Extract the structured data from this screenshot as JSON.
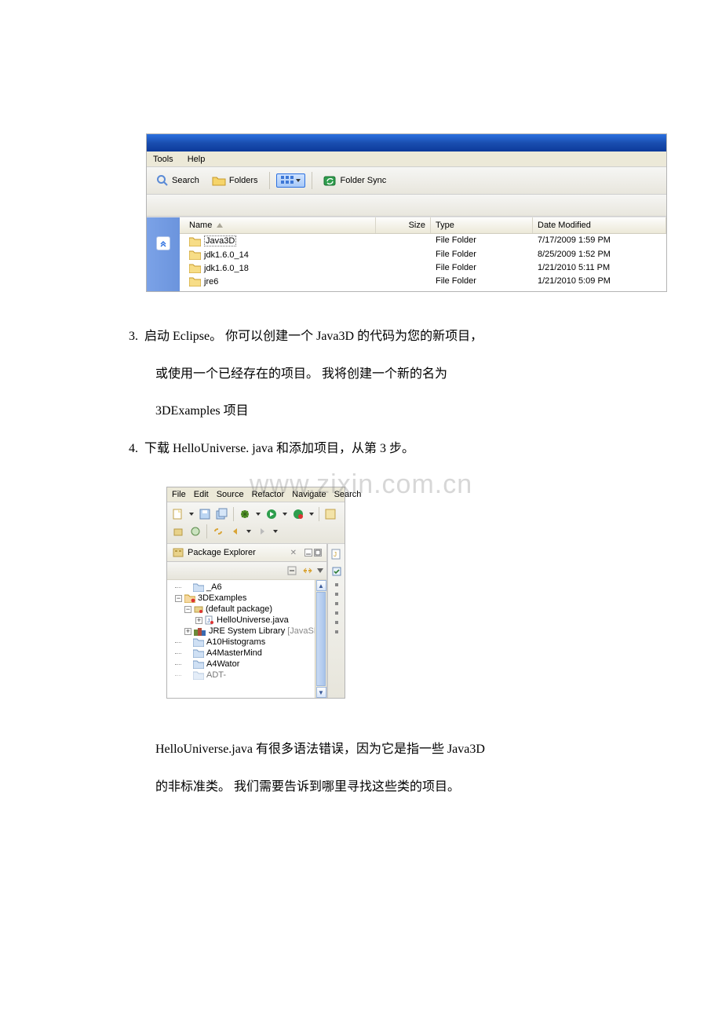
{
  "explorer": {
    "menus": {
      "tools": "Tools",
      "help": "Help"
    },
    "toolbar": {
      "search": "Search",
      "folders": "Folders",
      "folder_sync": "Folder Sync"
    },
    "columns": {
      "name": "Name",
      "size": "Size",
      "type": "Type",
      "date": "Date Modified"
    },
    "rows": [
      {
        "name": "Java3D",
        "type": "File Folder",
        "date": "7/17/2009 1:59 PM",
        "selected": true
      },
      {
        "name": "jdk1.6.0_14",
        "type": "File Folder",
        "date": "8/25/2009 1:52 PM",
        "selected": false
      },
      {
        "name": "jdk1.6.0_18",
        "type": "File Folder",
        "date": "1/21/2010 5:11 PM",
        "selected": false
      },
      {
        "name": "jre6",
        "type": "File Folder",
        "date": "1/21/2010 5:09 PM",
        "selected": false
      }
    ]
  },
  "doc": {
    "p3a": "启动 Eclipse。   你可以创建一个 Java3D 的代码为您的新项目，",
    "p3b": "或使用一个已经存在的项目。   我将创建一个新的名为",
    "p3c": "3DExamples 项目",
    "p4": "下载 HelloUniverse. java 和添加项目，从第 3 步。",
    "n3": "3.",
    "n4": "4.",
    "bottom1": "HelloUniverse.java 有很多语法错误，因为它是指一些 Java3D",
    "bottom2": "的非标准类。   我们需要告诉到哪里寻找这些类的项目。"
  },
  "watermark": "www.zixin.com.cn",
  "eclipse": {
    "menus": {
      "file": "File",
      "edit": "Edit",
      "source": "Source",
      "refactor": "Refactor",
      "navigate": "Navigate",
      "search": "Search"
    },
    "panel_title": "Package Explorer",
    "jre_suffix": "[JavaSE",
    "tree": {
      "a6": "_A6",
      "examples": "3DExamples",
      "defpkg": "(default package)",
      "hello": "HelloUniverse.java",
      "jre": "JRE System Library",
      "a10": "A10Histograms",
      "a4mm": "A4MasterMind",
      "a4wator": "A4Wator",
      "adt": "ADT-"
    }
  }
}
